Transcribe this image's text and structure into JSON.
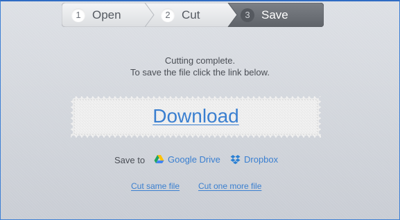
{
  "steps": [
    {
      "number": "1",
      "label": "Open"
    },
    {
      "number": "2",
      "label": "Cut"
    },
    {
      "number": "3",
      "label": "Save"
    }
  ],
  "active_step": "Save",
  "message": {
    "line1": "Cutting complete.",
    "line2": "To save the file click the link below."
  },
  "download": {
    "label": "Download"
  },
  "save_to": {
    "label": "Save to",
    "providers": [
      {
        "name": "Google Drive",
        "icon": "google-drive-icon"
      },
      {
        "name": "Dropbox",
        "icon": "dropbox-icon"
      }
    ]
  },
  "links": {
    "cut_same": "Cut same file",
    "cut_more": "Cut one more file"
  },
  "colors": {
    "link": "#3a7fd0",
    "active_step_bg": "#6e7278",
    "inactive_step_bg": "#e9eaec",
    "frame_border": "#3d7fd4"
  }
}
